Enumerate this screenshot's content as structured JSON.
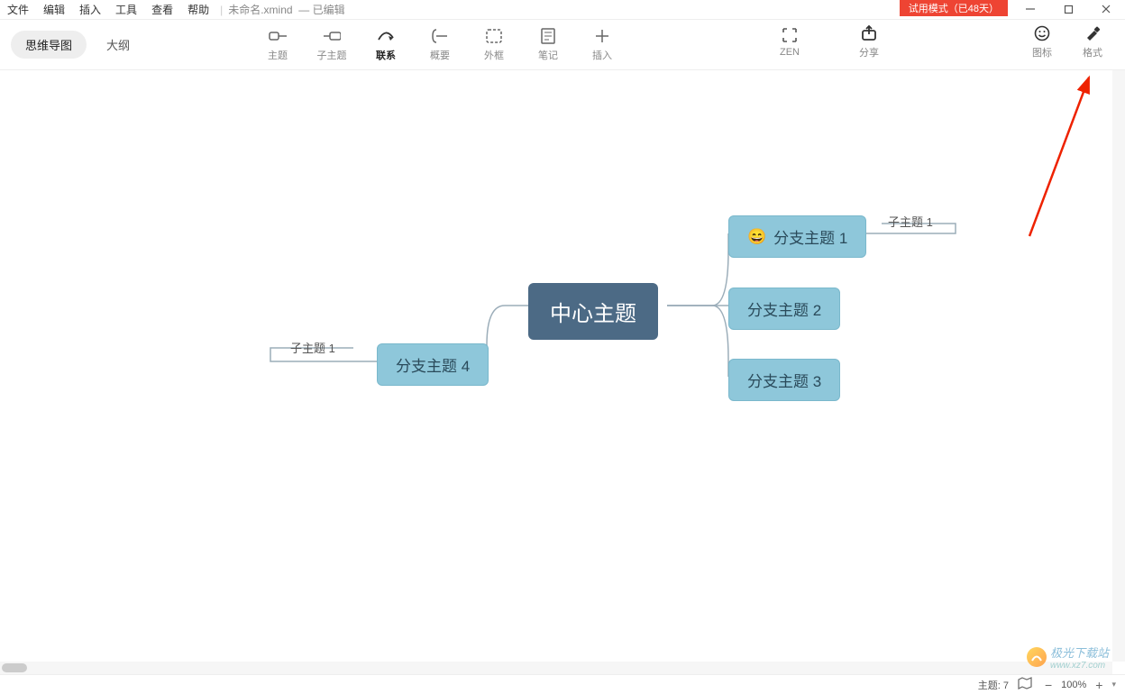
{
  "menu": {
    "items": [
      "文件",
      "编辑",
      "插入",
      "工具",
      "查看",
      "帮助"
    ],
    "doc_name": "未命名.xmind",
    "doc_state": "— 已编辑"
  },
  "trial_badge": "试用模式（已48天）",
  "view_tabs": {
    "mindmap": "思维导图",
    "outline": "大纲"
  },
  "tools": {
    "topic": "主题",
    "subtopic": "子主题",
    "relationship": "联系",
    "summary": "概要",
    "boundary": "外框",
    "note": "笔记",
    "insert": "插入",
    "zen": "ZEN",
    "share": "分享",
    "icons": "图标",
    "format": "格式"
  },
  "mindmap": {
    "center": "中心主题",
    "branches": [
      "分支主题 1",
      "分支主题 2",
      "分支主题 3",
      "分支主题 4"
    ],
    "sub_right": "子主题 1",
    "sub_left": "子主题 1",
    "emoji": "😄"
  },
  "status": {
    "topic_count_label": "主题:",
    "topic_count": "7",
    "zoom": "100%"
  },
  "watermark": {
    "text1": "极光下载站",
    "text2": "www.xz7.com"
  }
}
